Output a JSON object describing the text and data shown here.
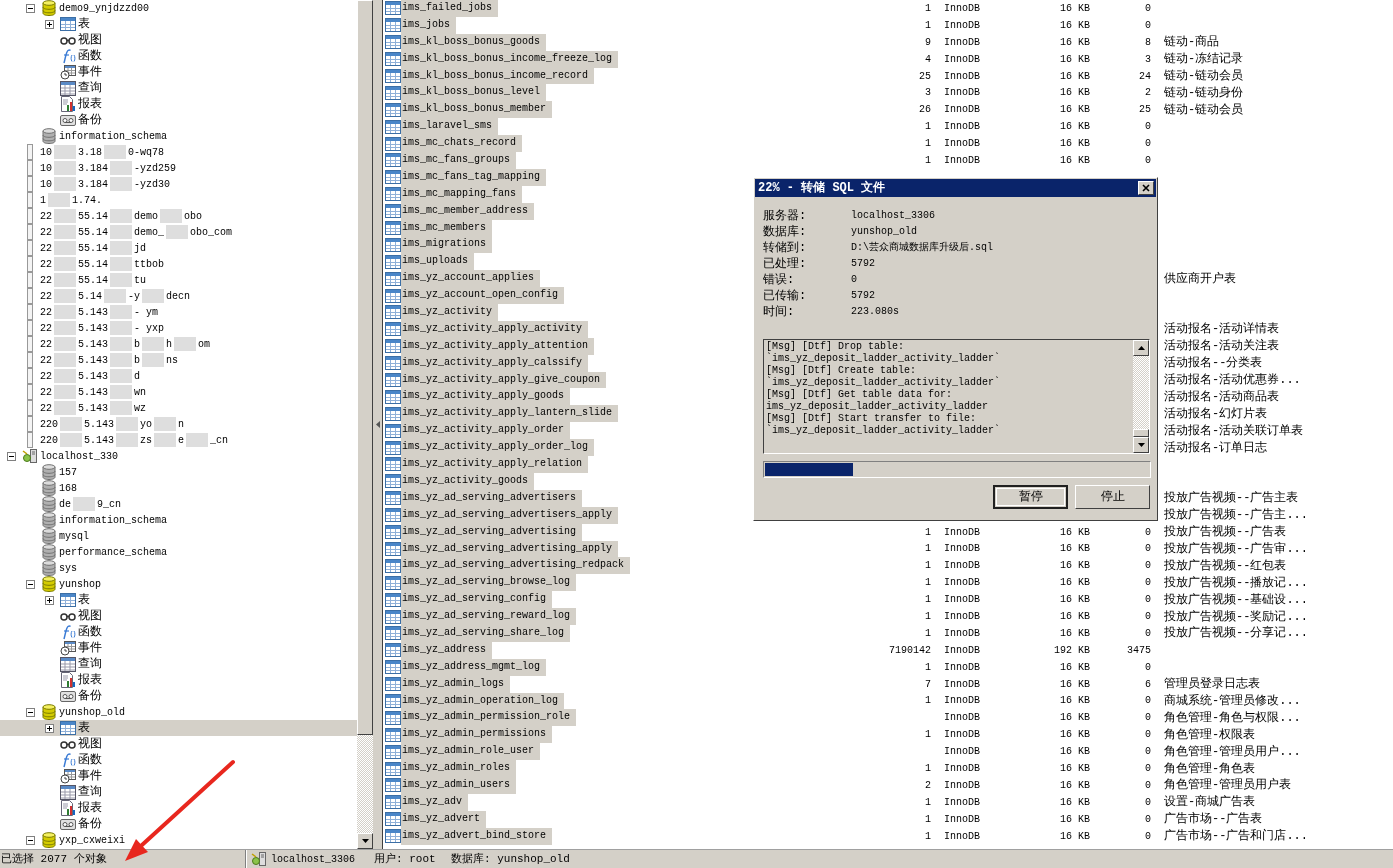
{
  "tree": {
    "cut_top": [
      {
        "kind": "database",
        "label": "demo9_ynjdzzd00",
        "open": true,
        "expanded": true,
        "selected": false,
        "children": [
          {
            "kind": "tables",
            "label": "表",
            "expanded": false,
            "selected": false
          },
          {
            "kind": "views",
            "label": "视图",
            "selected": false
          },
          {
            "kind": "functions",
            "label": "函数",
            "selected": false
          },
          {
            "kind": "events",
            "label": "事件",
            "selected": false
          },
          {
            "kind": "queries",
            "label": "查询",
            "selected": false
          },
          {
            "kind": "reports",
            "label": "报表",
            "selected": false
          },
          {
            "kind": "backups",
            "label": "备份",
            "selected": false
          }
        ]
      },
      {
        "kind": "database",
        "label": "information_schema",
        "open": false,
        "selected": false
      }
    ],
    "items": [
      {
        "kind": "connection",
        "parts": [
          "10",
          "3.18",
          "0-wq78"
        ],
        "selected": false
      },
      {
        "kind": "connection",
        "parts": [
          "10",
          "3.184",
          "-yzd259"
        ],
        "selected": false
      },
      {
        "kind": "connection",
        "parts": [
          "10",
          "3.184",
          "-yzd30"
        ],
        "selected": false
      },
      {
        "kind": "connection",
        "parts": [
          "1",
          "1.74."
        ],
        "selected": false
      },
      {
        "kind": "connection",
        "parts": [
          "22",
          "55.14",
          "demo",
          "obo"
        ],
        "selected": false
      },
      {
        "kind": "connection",
        "parts": [
          "22",
          "55.14",
          "demo_",
          "obo_com"
        ],
        "selected": false
      },
      {
        "kind": "connection",
        "parts": [
          "22",
          "55.14",
          "jd"
        ],
        "selected": false
      },
      {
        "kind": "connection",
        "parts": [
          "22",
          "55.14",
          "ttbob"
        ],
        "selected": false
      },
      {
        "kind": "connection",
        "parts": [
          "22",
          "55.14",
          "tu"
        ],
        "selected": false
      },
      {
        "kind": "connection",
        "parts": [
          "22",
          "5.14",
          "-y",
          "decn"
        ],
        "selected": false
      },
      {
        "kind": "connection",
        "parts": [
          "22",
          "5.143",
          "- ym"
        ],
        "selected": false
      },
      {
        "kind": "connection",
        "parts": [
          "22",
          "5.143",
          "- yxp"
        ],
        "selected": false
      },
      {
        "kind": "connection",
        "parts": [
          "22",
          "5.143",
          "b",
          "h",
          "om"
        ],
        "selected": false
      },
      {
        "kind": "connection",
        "parts": [
          "22",
          "5.143",
          "b",
          "ns"
        ],
        "selected": false
      },
      {
        "kind": "connection",
        "parts": [
          "22",
          "5.143",
          "d"
        ],
        "selected": false
      },
      {
        "kind": "connection",
        "parts": [
          "22",
          "5.143",
          "wn"
        ],
        "selected": false
      },
      {
        "kind": "connection",
        "parts": [
          "22",
          "5.143",
          "wz"
        ],
        "selected": false
      },
      {
        "kind": "connection",
        "parts": [
          "220",
          "5.143",
          "yo",
          "n"
        ],
        "selected": false
      },
      {
        "kind": "connection",
        "parts": [
          "220",
          "5.143",
          "zs",
          "e",
          "_cn"
        ],
        "selected": false
      },
      {
        "kind": "server",
        "label": "localhost_330",
        "expanded": true,
        "selected": false,
        "children": [
          {
            "kind": "database",
            "label": "157",
            "open": false,
            "selected": false
          },
          {
            "kind": "database",
            "label": "168",
            "open": false,
            "selected": false
          },
          {
            "kind": "database",
            "parts": [
              "de",
              "9_cn"
            ],
            "open": false,
            "selected": false
          },
          {
            "kind": "database",
            "label": "information_schema",
            "open": false,
            "selected": false
          },
          {
            "kind": "database",
            "label": "mysql",
            "open": false,
            "selected": false
          },
          {
            "kind": "database",
            "label": "performance_schema",
            "open": false,
            "selected": false
          },
          {
            "kind": "database",
            "label": "sys",
            "open": false,
            "selected": false
          },
          {
            "kind": "database",
            "label": "yunshop",
            "open": true,
            "expanded": true,
            "selected": false,
            "children": [
              {
                "kind": "tables",
                "label": "表",
                "expanded": false,
                "selected": false
              },
              {
                "kind": "views",
                "label": "视图",
                "selected": false
              },
              {
                "kind": "functions",
                "label": "函数",
                "selected": false
              },
              {
                "kind": "events",
                "label": "事件",
                "selected": false
              },
              {
                "kind": "queries",
                "label": "查询",
                "selected": false
              },
              {
                "kind": "reports",
                "label": "报表",
                "selected": false
              },
              {
                "kind": "backups",
                "label": "备份",
                "selected": false
              }
            ]
          },
          {
            "kind": "database",
            "label": "yunshop_old",
            "open": true,
            "expanded": true,
            "selected": false,
            "children": [
              {
                "kind": "tables",
                "label": "表",
                "expanded": false,
                "selected": true
              },
              {
                "kind": "views",
                "label": "视图",
                "selected": false
              },
              {
                "kind": "functions",
                "label": "函数",
                "selected": false
              },
              {
                "kind": "events",
                "label": "事件",
                "selected": false
              },
              {
                "kind": "queries",
                "label": "查询",
                "selected": false
              },
              {
                "kind": "reports",
                "label": "报表",
                "selected": false
              },
              {
                "kind": "backups",
                "label": "备份",
                "selected": false
              }
            ]
          },
          {
            "kind": "database",
            "label": "yxp_cxweixi",
            "open": true,
            "expanded": true,
            "selected": false
          }
        ]
      }
    ]
  },
  "tables": [
    {
      "name": "ims_failed_jobs",
      "count": "1",
      "engine": "InnoDB",
      "size": "16 KB",
      "auto_increment": "0",
      "selected": true
    },
    {
      "name": "ims_jobs",
      "count": "1",
      "engine": "InnoDB",
      "size": "16 KB",
      "auto_increment": "0",
      "selected": true
    },
    {
      "name": "ims_kl_boss_bonus_goods",
      "count": "9",
      "engine": "InnoDB",
      "size": "16 KB",
      "auto_increment": "8",
      "comment": "链动-商品",
      "selected": true
    },
    {
      "name": "ims_kl_boss_bonus_income_freeze_log",
      "count": "4",
      "engine": "InnoDB",
      "size": "16 KB",
      "auto_increment": "3",
      "comment": "链动-冻结记录",
      "selected": true
    },
    {
      "name": "ims_kl_boss_bonus_income_record",
      "count": "25",
      "engine": "InnoDB",
      "size": "16 KB",
      "auto_increment": "24",
      "comment": "链动-链动会员",
      "selected": true
    },
    {
      "name": "ims_kl_boss_bonus_level",
      "count": "3",
      "engine": "InnoDB",
      "size": "16 KB",
      "auto_increment": "2",
      "comment": "链动-链动身份",
      "selected": true
    },
    {
      "name": "ims_kl_boss_bonus_member",
      "count": "26",
      "engine": "InnoDB",
      "size": "16 KB",
      "auto_increment": "25",
      "comment": "链动-链动会员",
      "selected": true
    },
    {
      "name": "ims_laravel_sms",
      "count": "1",
      "engine": "InnoDB",
      "size": "16 KB",
      "auto_increment": "0",
      "selected": true
    },
    {
      "name": "ims_mc_chats_record",
      "count": "1",
      "engine": "InnoDB",
      "size": "16 KB",
      "auto_increment": "0",
      "selected": true
    },
    {
      "name": "ims_mc_fans_groups",
      "count": "1",
      "engine": "InnoDB",
      "size": "16 KB",
      "auto_increment": "0",
      "selected": true
    },
    {
      "name": "ims_mc_fans_tag_mapping",
      "selected": true
    },
    {
      "name": "ims_mc_mapping_fans",
      "selected": true
    },
    {
      "name": "ims_mc_member_address",
      "selected": true
    },
    {
      "name": "ims_mc_members",
      "selected": true
    },
    {
      "name": "ims_migrations",
      "selected": true
    },
    {
      "name": "ims_uploads",
      "selected": true
    },
    {
      "name": "ims_yz_account_applies",
      "comment": "供应商开户表",
      "selected": true
    },
    {
      "name": "ims_yz_account_open_config",
      "selected": true
    },
    {
      "name": "ims_yz_activity",
      "selected": true
    },
    {
      "name": "ims_yz_activity_apply_activity",
      "comment": "活动报名-活动详情表",
      "selected": true
    },
    {
      "name": "ims_yz_activity_apply_attention",
      "comment": "活动报名-活动关注表",
      "selected": true
    },
    {
      "name": "ims_yz_activity_apply_calssify",
      "comment": "活动报名--分类表",
      "selected": true
    },
    {
      "name": "ims_yz_activity_apply_give_coupon",
      "comment": "活动报名-活动优惠券...",
      "selected": true
    },
    {
      "name": "ims_yz_activity_apply_goods",
      "comment": "活动报名-活动商品表",
      "selected": true
    },
    {
      "name": "ims_yz_activity_apply_lantern_slide",
      "comment": "活动报名-幻灯片表",
      "selected": true
    },
    {
      "name": "ims_yz_activity_apply_order",
      "comment": "活动报名-活动关联订单表",
      "selected": true
    },
    {
      "name": "ims_yz_activity_apply_order_log",
      "comment": "活动报名-订单日志",
      "selected": true
    },
    {
      "name": "ims_yz_activity_apply_relation",
      "selected": true
    },
    {
      "name": "ims_yz_activity_goods",
      "selected": true
    },
    {
      "name": "ims_yz_ad_serving_advertisers",
      "comment": "投放广告视频--广告主表",
      "selected": true
    },
    {
      "name": "ims_yz_ad_serving_advertisers_apply",
      "comment": "投放广告视频--广告主...",
      "selected": true
    },
    {
      "name": "ims_yz_ad_serving_advertising",
      "count": "1",
      "engine": "InnoDB",
      "size": "16 KB",
      "auto_increment": "0",
      "comment": "投放广告视频--广告表",
      "selected": true
    },
    {
      "name": "ims_yz_ad_serving_advertising_apply",
      "count": "1",
      "engine": "InnoDB",
      "size": "16 KB",
      "auto_increment": "0",
      "comment": "投放广告视频--广告审...",
      "selected": true
    },
    {
      "name": "ims_yz_ad_serving_advertising_redpack",
      "count": "1",
      "engine": "InnoDB",
      "size": "16 KB",
      "auto_increment": "0",
      "comment": "投放广告视频--红包表",
      "selected": true
    },
    {
      "name": "ims_yz_ad_serving_browse_log",
      "count": "1",
      "engine": "InnoDB",
      "size": "16 KB",
      "auto_increment": "0",
      "comment": "投放广告视频--播放记...",
      "selected": true
    },
    {
      "name": "ims_yz_ad_serving_config",
      "count": "1",
      "engine": "InnoDB",
      "size": "16 KB",
      "auto_increment": "0",
      "comment": "投放广告视频--基础设...",
      "selected": true
    },
    {
      "name": "ims_yz_ad_serving_reward_log",
      "count": "1",
      "engine": "InnoDB",
      "size": "16 KB",
      "auto_increment": "0",
      "comment": "投放广告视频--奖励记...",
      "selected": true
    },
    {
      "name": "ims_yz_ad_serving_share_log",
      "count": "1",
      "engine": "InnoDB",
      "size": "16 KB",
      "auto_increment": "0",
      "comment": "投放广告视频--分享记...",
      "selected": true
    },
    {
      "name": "ims_yz_address",
      "count": "7190142",
      "engine": "InnoDB",
      "size": "192 KB",
      "auto_increment": "3475",
      "selected": true
    },
    {
      "name": "ims_yz_address_mgmt_log",
      "count": "1",
      "engine": "InnoDB",
      "size": "16 KB",
      "auto_increment": "0",
      "selected": true
    },
    {
      "name": "ims_yz_admin_logs",
      "count": "7",
      "engine": "InnoDB",
      "size": "16 KB",
      "auto_increment": "6",
      "comment": "管理员登录日志表",
      "selected": true
    },
    {
      "name": "ims_yz_admin_operation_log",
      "count": "1",
      "engine": "InnoDB",
      "size": "16 KB",
      "auto_increment": "0",
      "comment": "商城系统-管理员修改...",
      "selected": true
    },
    {
      "name": "ims_yz_admin_permission_role",
      "engine": "InnoDB",
      "size": "16 KB",
      "auto_increment": "0",
      "comment": "角色管理-角色与权限...",
      "selected": true
    },
    {
      "name": "ims_yz_admin_permissions",
      "count": "1",
      "engine": "InnoDB",
      "size": "16 KB",
      "auto_increment": "0",
      "comment": "角色管理-权限表",
      "selected": true
    },
    {
      "name": "ims_yz_admin_role_user",
      "engine": "InnoDB",
      "size": "16 KB",
      "auto_increment": "0",
      "comment": "角色管理-管理员用户...",
      "selected": true
    },
    {
      "name": "ims_yz_admin_roles",
      "count": "1",
      "engine": "InnoDB",
      "size": "16 KB",
      "auto_increment": "0",
      "comment": "角色管理-角色表",
      "selected": true
    },
    {
      "name": "ims_yz_admin_users",
      "count": "2",
      "engine": "InnoDB",
      "size": "16 KB",
      "auto_increment": "0",
      "comment": "角色管理-管理员用户表",
      "selected": true
    },
    {
      "name": "ims_yz_adv",
      "count": "1",
      "engine": "InnoDB",
      "size": "16 KB",
      "auto_increment": "0",
      "comment": "设置-商城广告表",
      "selected": true
    },
    {
      "name": "ims_yz_advert",
      "count": "1",
      "engine": "InnoDB",
      "size": "16 KB",
      "auto_increment": "0",
      "comment": "广告市场--广告表",
      "selected": true
    },
    {
      "name": "ims_yz_advert_bind_store",
      "count": "1",
      "engine": "InnoDB",
      "size": "16 KB",
      "auto_increment": "0",
      "comment": "广告市场--广告和门店...",
      "selected": true
    }
  ],
  "dialog": {
    "title": "22% - 转储 SQL 文件",
    "fields": [
      {
        "label": "服务器:",
        "value": "localhost_3306"
      },
      {
        "label": "数据库:",
        "value": "yunshop_old"
      },
      {
        "label": "转储到:",
        "value": "D:\\芸众商城数据库升级后.sql"
      },
      {
        "label": "已处理:",
        "value": "5792"
      },
      {
        "label": "错误:",
        "value": "0"
      },
      {
        "label": "已传输:",
        "value": "5792"
      },
      {
        "label": "时间:",
        "value": "223.080s"
      }
    ],
    "log": [
      "[Msg] [Dtf] Drop table:",
      "`ims_yz_deposit_ladder_activity_ladder`",
      "[Msg] [Dtf] Create table:",
      "`ims_yz_deposit_ladder_activity_ladder`",
      "[Msg] [Dtf] Get table data for:",
      "ims_yz_deposit_ladder_activity_ladder",
      "[Msg] [Dtf] Start transfer to file:",
      "`ims_yz_deposit_ladder_activity_ladder`"
    ],
    "progress": {
      "level": 0.23
    },
    "buttons": [
      {
        "label": "暂停",
        "default": true
      },
      {
        "label": "停止",
        "default": false
      }
    ]
  },
  "status_bar": {
    "selection": "已选择 2077 个对象",
    "server": "localhost_3306",
    "user": "用户: root",
    "database": "数据库: yunshop_old"
  }
}
